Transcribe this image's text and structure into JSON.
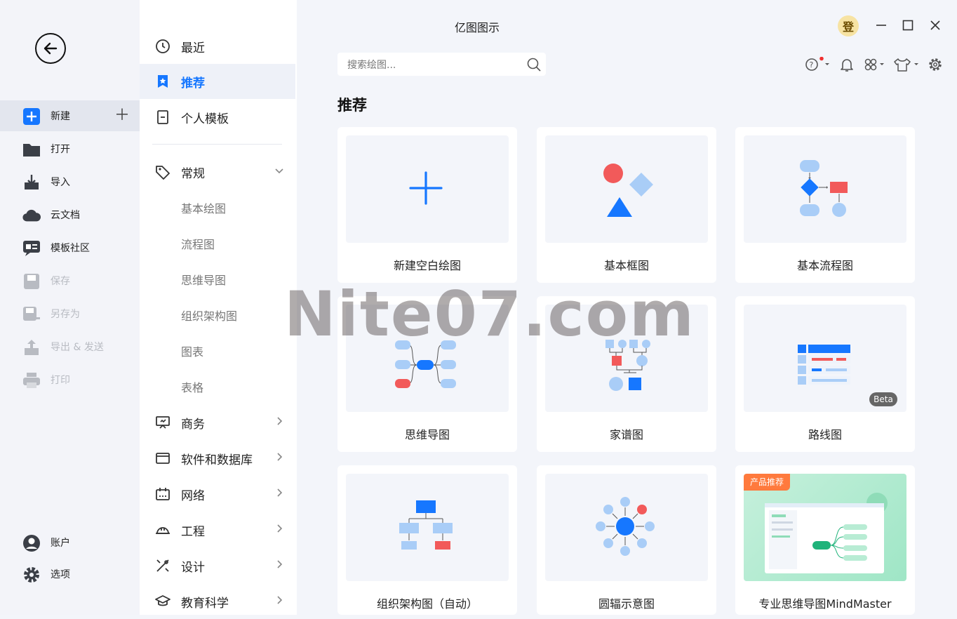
{
  "window": {
    "title": "亿图图示",
    "avatar_text": "登"
  },
  "rail": {
    "items": [
      {
        "label": "新建"
      },
      {
        "label": "打开"
      },
      {
        "label": "导入"
      },
      {
        "label": "云文档"
      },
      {
        "label": "模板社区"
      },
      {
        "label": "保存"
      },
      {
        "label": "另存为"
      },
      {
        "label": "导出 & 发送"
      },
      {
        "label": "打印"
      }
    ],
    "bottom": [
      {
        "label": "账户"
      },
      {
        "label": "选项"
      }
    ]
  },
  "categories": {
    "top": [
      {
        "label": "最近"
      },
      {
        "label": "推荐"
      },
      {
        "label": "个人模板"
      }
    ],
    "general": {
      "label": "常规"
    },
    "general_sub": [
      {
        "label": "基本绘图"
      },
      {
        "label": "流程图"
      },
      {
        "label": "思维导图"
      },
      {
        "label": "组织架构图"
      },
      {
        "label": "图表"
      },
      {
        "label": "表格"
      }
    ],
    "more": [
      {
        "label": "商务"
      },
      {
        "label": "软件和数据库"
      },
      {
        "label": "网络"
      },
      {
        "label": "工程"
      },
      {
        "label": "设计"
      },
      {
        "label": "教育科学"
      }
    ]
  },
  "search": {
    "placeholder": "搜索绘图..."
  },
  "main": {
    "section_title": "推荐",
    "cards": [
      {
        "label": "新建空白绘图"
      },
      {
        "label": "基本框图"
      },
      {
        "label": "基本流程图"
      },
      {
        "label": "思维导图"
      },
      {
        "label": "家谱图"
      },
      {
        "label": "路线图",
        "badge": "Beta"
      },
      {
        "label": "组织架构图（自动）"
      },
      {
        "label": "圆辐示意图"
      },
      {
        "label": "专业思维导图MindMaster",
        "badge": "产品推荐"
      }
    ]
  },
  "watermark": "Nite07.com",
  "colors": {
    "accent": "#1677ff",
    "red": "#f25a5a",
    "light_blue": "#a9cdf7",
    "bg": "#f3f5fa"
  }
}
